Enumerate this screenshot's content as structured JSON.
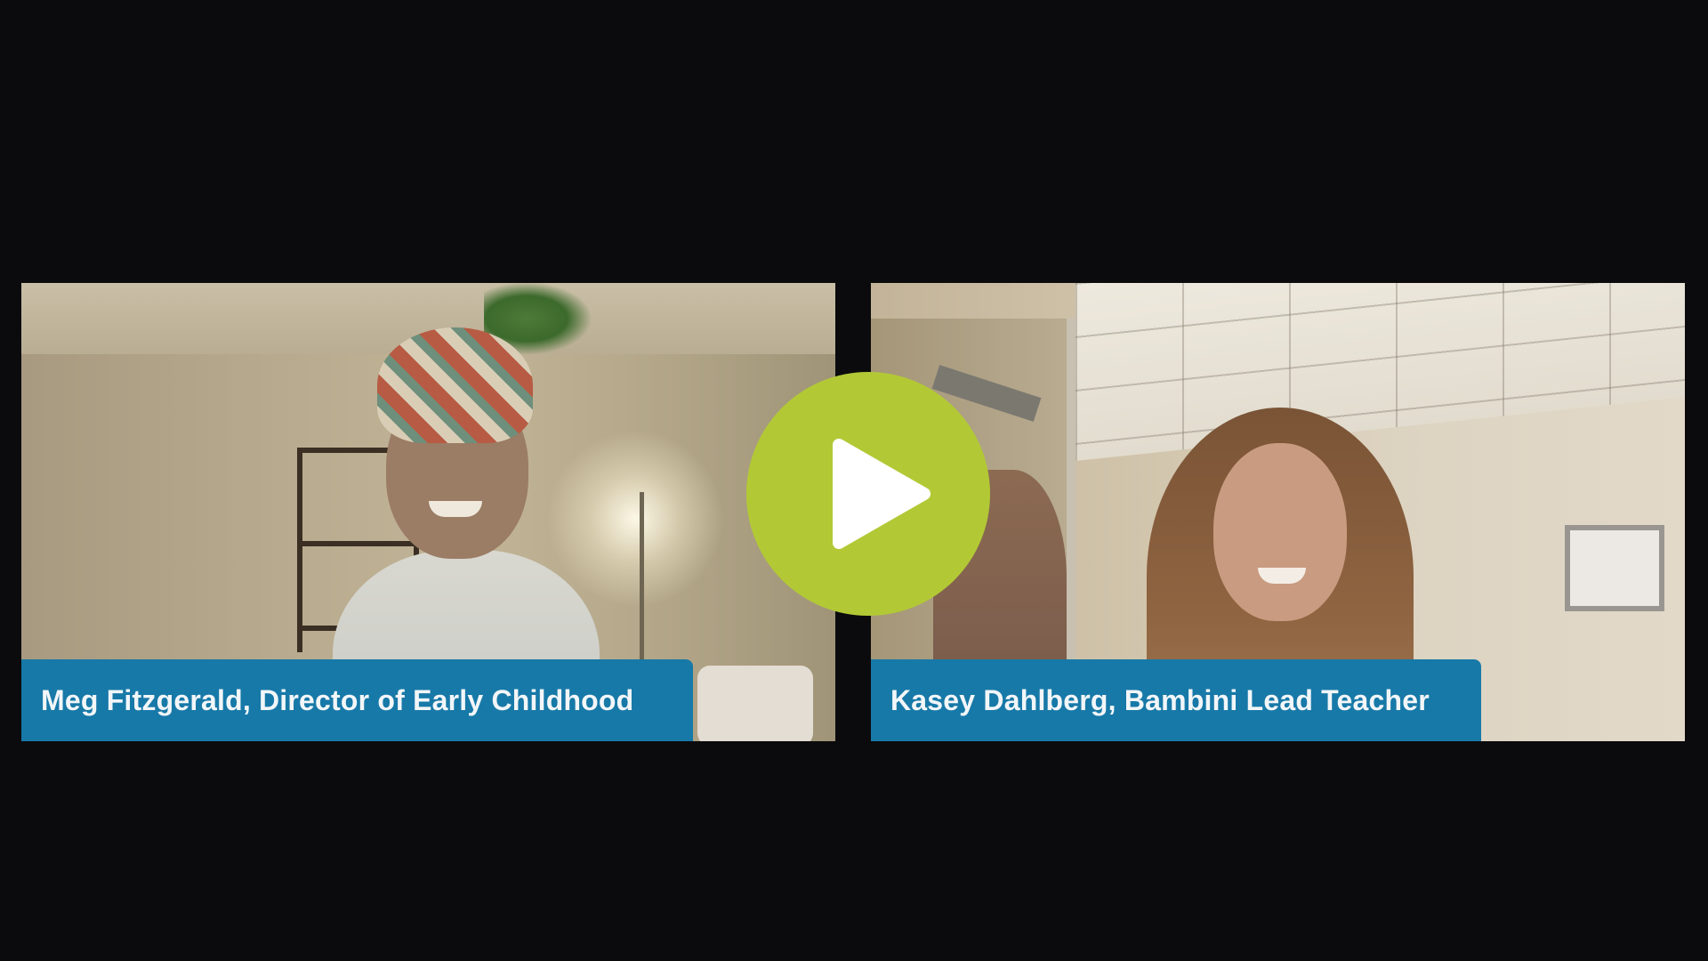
{
  "participants": [
    {
      "caption": "Meg Fitzgerald, Director of Early Childhood"
    },
    {
      "caption": "Kasey Dahlberg, Bambini Lead Teacher"
    }
  ],
  "player": {
    "play_icon": "play-icon",
    "accent_color": "#b2c935",
    "caption_bar_color": "#1779a8",
    "background_color": "#0b0b0d"
  }
}
